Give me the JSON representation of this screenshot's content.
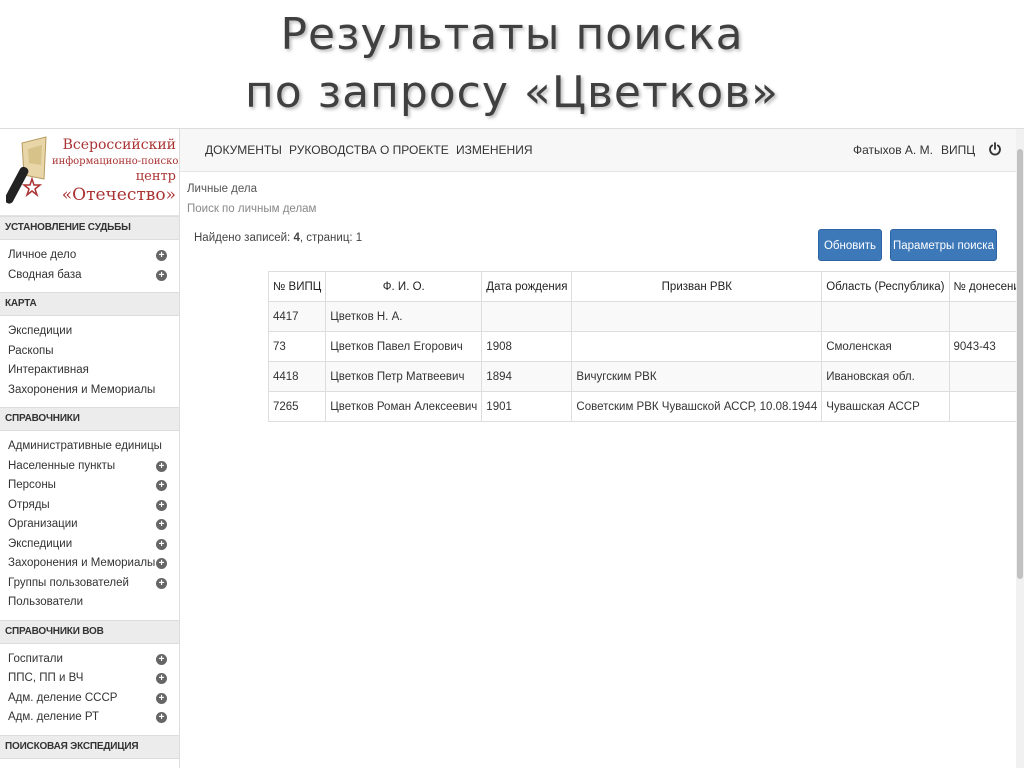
{
  "slide": {
    "title_line1": "Результаты поиска",
    "title_line2": "по запросу «Цветков»"
  },
  "logo": {
    "line1": "Всероссийский",
    "line2": "информационно-поисковый",
    "line3": "центр",
    "line4": "«Отечество»"
  },
  "sidebar": {
    "sections": [
      {
        "title": "УСТАНОВЛЕНИЕ СУДЬБЫ",
        "items": [
          {
            "label": "Личное дело",
            "plus": true
          },
          {
            "label": "Сводная база",
            "plus": true
          }
        ]
      },
      {
        "title": "КАРТА",
        "items": [
          {
            "label": "Экспедиции",
            "plus": false
          },
          {
            "label": "Раскопы",
            "plus": false
          },
          {
            "label": "Интерактивная",
            "plus": false
          },
          {
            "label": "Захоронения и Мемориалы",
            "plus": false
          }
        ]
      },
      {
        "title": "СПРАВОЧНИКИ",
        "items": [
          {
            "label": "Административные единицы",
            "plus": false
          },
          {
            "label": "Населенные пункты",
            "plus": true
          },
          {
            "label": "Персоны",
            "plus": true
          },
          {
            "label": "Отряды",
            "plus": true
          },
          {
            "label": "Организации",
            "plus": true
          },
          {
            "label": "Экспедиции",
            "plus": true
          },
          {
            "label": "Захоронения и Мемориалы",
            "plus": true
          },
          {
            "label": "Группы пользователей",
            "plus": true
          },
          {
            "label": "Пользователи",
            "plus": false
          }
        ]
      },
      {
        "title": "СПРАВОЧНИКИ ВОВ",
        "items": [
          {
            "label": "Госпитали",
            "plus": true
          },
          {
            "label": "ППС, ПП и ВЧ",
            "plus": true
          },
          {
            "label": "Адм. деление СССР",
            "plus": true
          },
          {
            "label": "Адм. деление РТ",
            "plus": true
          }
        ]
      },
      {
        "title": "ПОИСКОВАЯ ЭКСПЕДИЦИЯ",
        "items": []
      }
    ]
  },
  "topnav": {
    "documents": "ДОКУМЕНТЫ",
    "guides": "РУКОВОДСТВА",
    "about": "О ПРОЕКТЕ",
    "changes": "ИЗМЕНЕНИЯ",
    "user": "Фатыхов А. М.",
    "org": "ВИПЦ",
    "logout_icon": "power-icon"
  },
  "main": {
    "breadcrumb": "Личные дела",
    "subtitle": "Поиск по личным делам",
    "found_prefix": "Найдено записей: ",
    "found_count": "4",
    "found_suffix": ", страниц: 1",
    "refresh_button": "Обновить",
    "params_button": "Параметры поиска"
  },
  "table": {
    "headers": [
      "№ ВИПЦ",
      "Ф. И. О.",
      "Дата рождения",
      "Призван РВК",
      "Область (Республика)",
      "№ донесения"
    ],
    "rows": [
      [
        "4417",
        "Цветков Н. А.",
        "",
        "",
        "",
        ""
      ],
      [
        "73",
        "Цветков Павел Егорович",
        "1908",
        "",
        "Смоленская",
        "9043-43"
      ],
      [
        "4418",
        "Цветков Петр Матвеевич",
        "1894",
        "Вичугским РВК",
        "Ивановская обл.",
        ""
      ],
      [
        "7265",
        "Цветков Роман Алексеевич",
        "1901",
        "Советским РВК Чувашской АССР, 10.08.1944",
        "Чувашская АССР",
        ""
      ]
    ]
  },
  "colors": {
    "button": "#3d78b9",
    "logo_red": "#aa3333"
  }
}
